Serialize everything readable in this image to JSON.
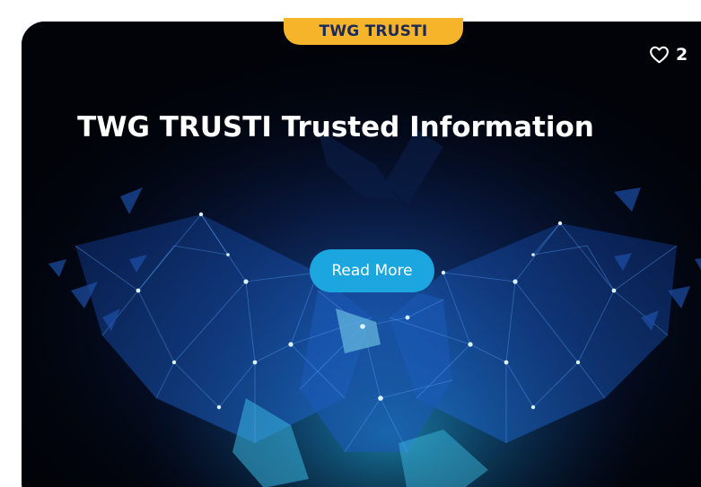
{
  "card": {
    "category_badge": "TWG TRUSTI",
    "title": "TWG TRUSTI Trusted Information",
    "like_count": "2",
    "like_icon": "heart-outline-icon",
    "read_more_label": "Read More"
  },
  "colors": {
    "badge_background": "#f5b429",
    "badge_text": "#1b2a57",
    "button_background": "#1ba6e0",
    "card_background": "#010309",
    "network_glow": "#2c8cf0"
  }
}
